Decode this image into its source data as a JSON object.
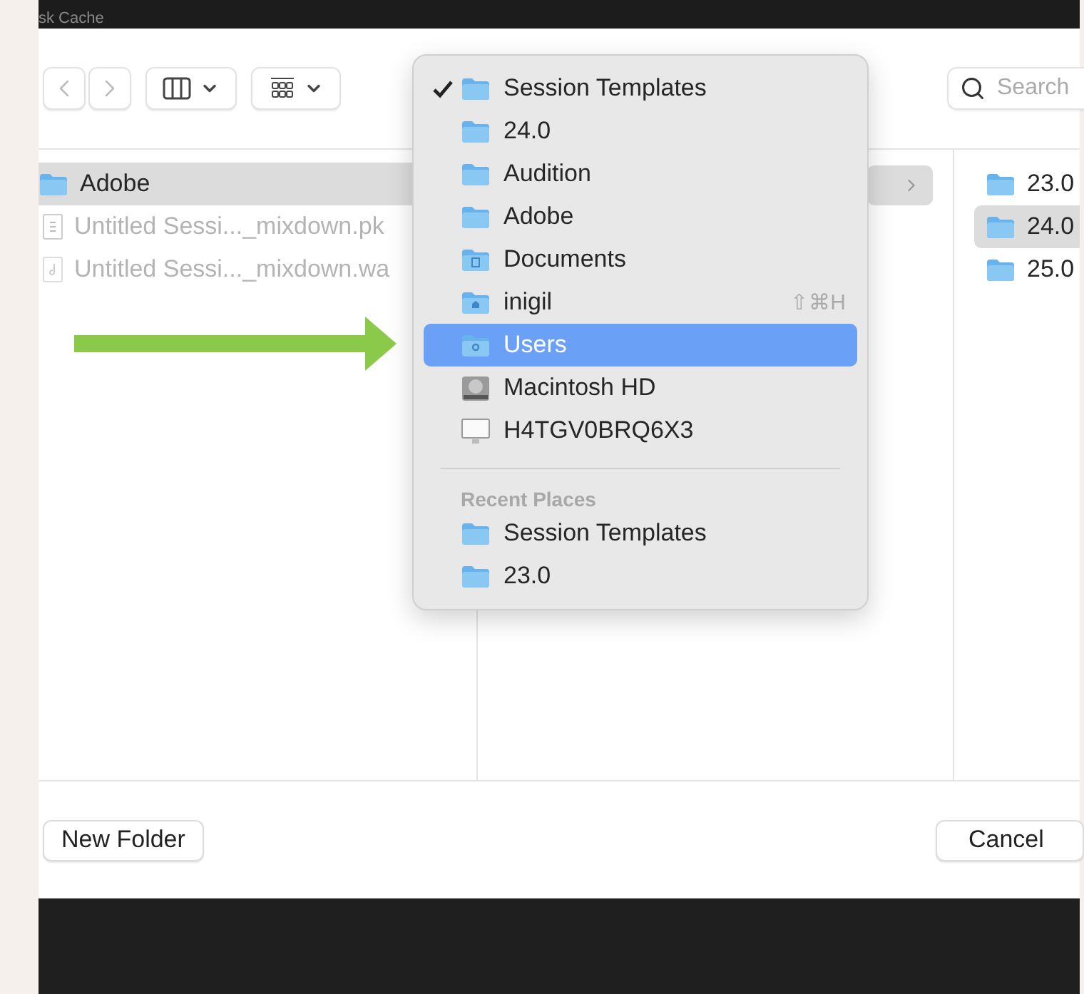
{
  "window": {
    "title": "sk Cache"
  },
  "toolbar": {
    "search": {
      "placeholder": "Search"
    }
  },
  "columns": [
    {
      "rows": [
        {
          "label": "Adobe",
          "kind": "folder",
          "selected": true,
          "disabled": false
        },
        {
          "label": "Untitled Sessi..._mixdown.pk",
          "kind": "file",
          "selected": false,
          "disabled": true
        },
        {
          "label": "Untitled Sessi..._mixdown.wa",
          "kind": "audio",
          "selected": false,
          "disabled": true
        }
      ]
    },
    {
      "rows": [
        {
          "kind": "branch",
          "selected": true
        }
      ]
    },
    {
      "rows": [
        {
          "label": "23.0",
          "kind": "folder",
          "selected": false
        },
        {
          "label": "24.0",
          "kind": "folder",
          "selected": true
        },
        {
          "label": "25.0",
          "kind": "folder",
          "selected": false
        }
      ]
    }
  ],
  "location_menu": {
    "items": [
      {
        "label": "Session Templates",
        "kind": "folder",
        "checked": true,
        "selected": false
      },
      {
        "label": "24.0",
        "kind": "folder",
        "checked": false,
        "selected": false
      },
      {
        "label": "Audition",
        "kind": "folder",
        "checked": false,
        "selected": false
      },
      {
        "label": "Adobe",
        "kind": "folder",
        "checked": false,
        "selected": false
      },
      {
        "label": "Documents",
        "kind": "documents",
        "checked": false,
        "selected": false
      },
      {
        "label": "inigil",
        "kind": "home",
        "checked": false,
        "selected": false,
        "shortcut": "⇧⌘H"
      },
      {
        "label": "Users",
        "kind": "users",
        "checked": false,
        "selected": true
      },
      {
        "label": "Macintosh HD",
        "kind": "disk",
        "checked": false,
        "selected": false
      },
      {
        "label": "H4TGV0BRQ6X3",
        "kind": "computer",
        "checked": false,
        "selected": false
      }
    ],
    "recent_header": "Recent Places",
    "recent": [
      {
        "label": "Session Templates",
        "kind": "folder",
        "checked": false,
        "selected": false
      },
      {
        "label": "23.0",
        "kind": "folder",
        "checked": false,
        "selected": false
      }
    ]
  },
  "buttons": {
    "new_folder": "New Folder",
    "cancel": "Cancel"
  }
}
